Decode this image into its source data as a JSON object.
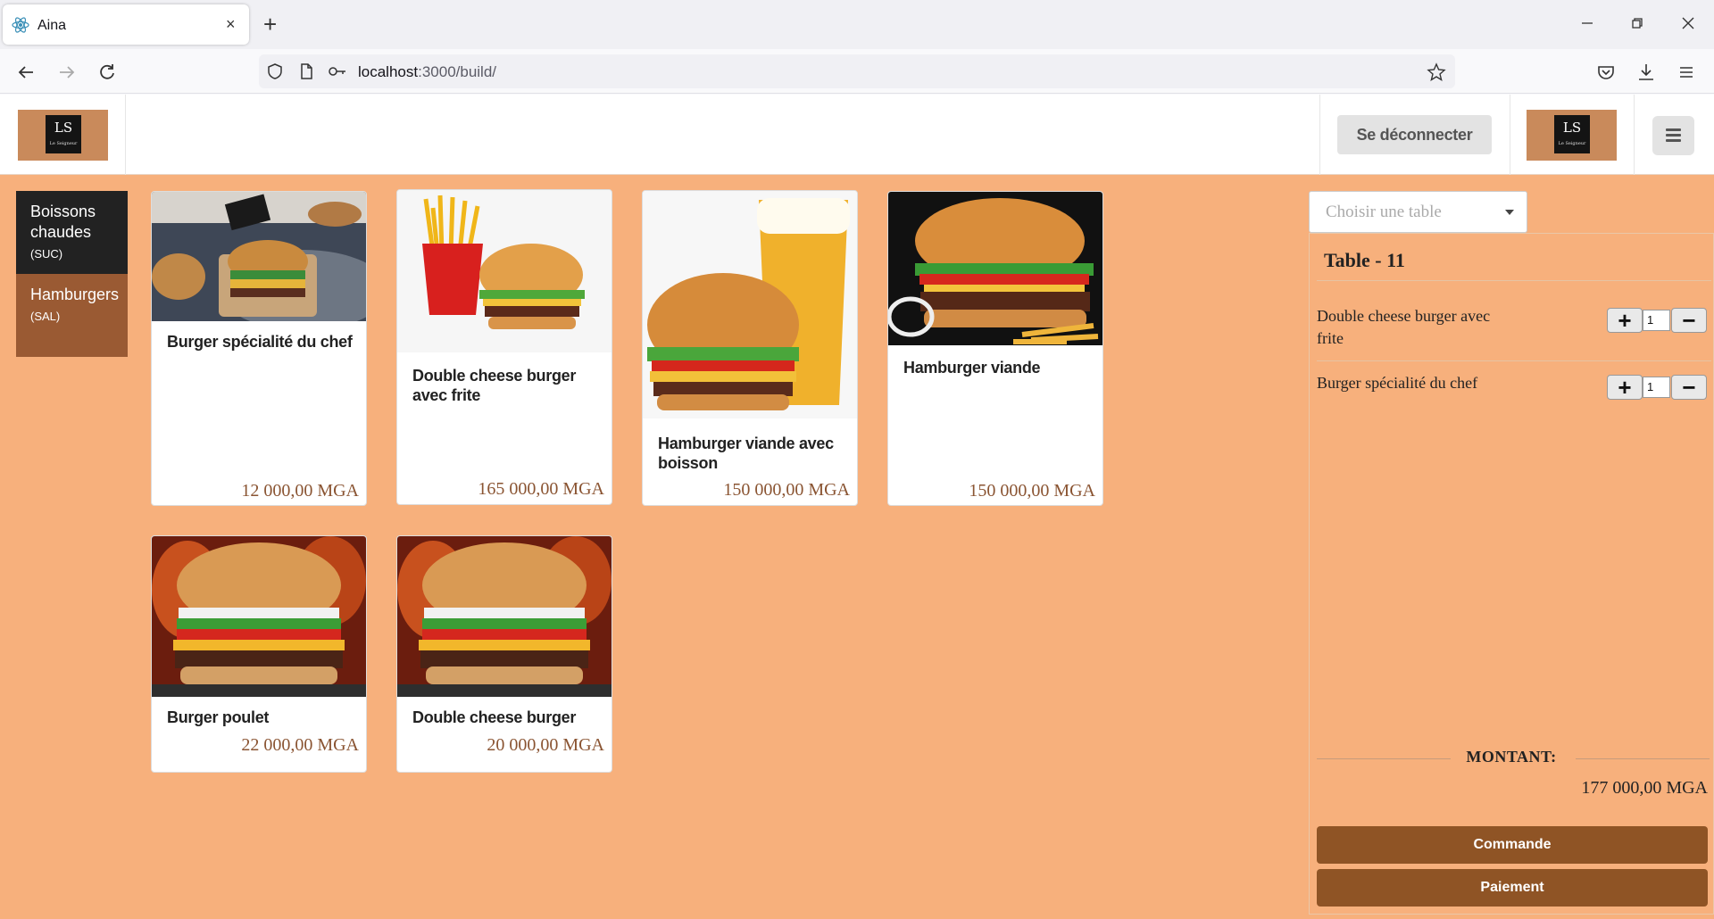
{
  "browser": {
    "tab_title": "Aina",
    "new_tab": "+",
    "tab_close": "×",
    "url_host": "localhost",
    "url_rest": ":3000/build/"
  },
  "header": {
    "logo_text": "LS",
    "logo_subtext": "Le Seigneur",
    "logout_label": "Se déconnecter"
  },
  "categories": [
    {
      "label": "Boissons chaudes",
      "code": "(SUC)"
    },
    {
      "label": "Hamburgers",
      "code": "(SAL)"
    }
  ],
  "products": [
    {
      "name": "Burger spécialité du chef",
      "price": "12 000,00 MGA"
    },
    {
      "name": "Double cheese burger avec frite",
      "price": "165 000,00 MGA"
    },
    {
      "name": "Hamburger viande avec boisson",
      "price": "150 000,00 MGA"
    },
    {
      "name": "Hamburger viande",
      "price": "150 000,00 MGA"
    },
    {
      "name": "Burger poulet",
      "price": "22 000,00 MGA"
    },
    {
      "name": "Double cheese burger",
      "price": "20 000,00 MGA"
    }
  ],
  "order": {
    "table_placeholder": "Choisir une table",
    "table_title": "Table - 11",
    "items": [
      {
        "name": "Double cheese burger avec frite",
        "qty": "1"
      },
      {
        "name": "Burger spécialité du chef",
        "qty": "1"
      }
    ],
    "montant_label": "MONTANT:",
    "montant_value": "177 000,00 MGA",
    "commande_label": "Commande",
    "paiement_label": "Paiement"
  }
}
